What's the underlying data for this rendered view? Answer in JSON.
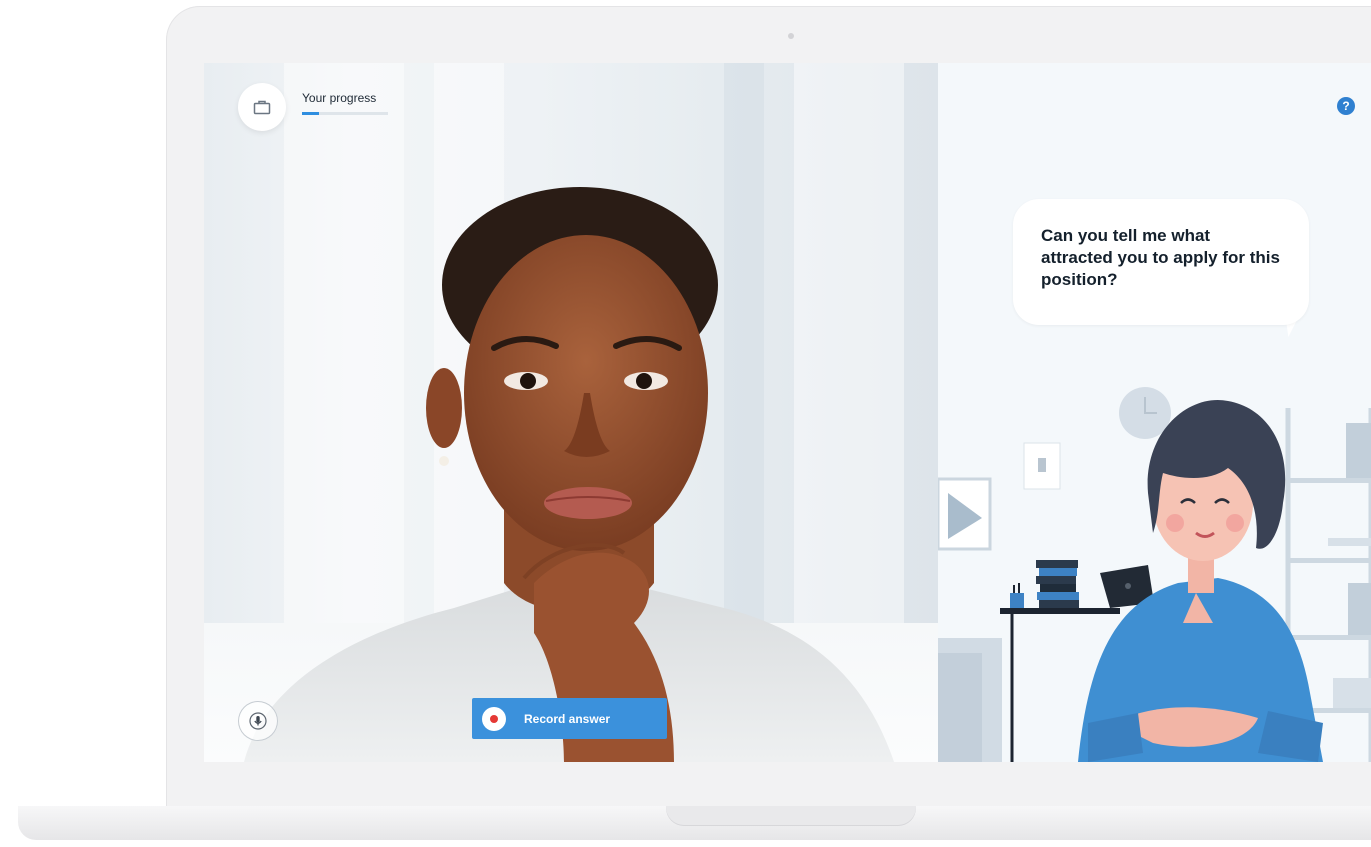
{
  "progress": {
    "label": "Your progress",
    "fraction": 0.2,
    "icon": "briefcase-icon"
  },
  "controls": {
    "mic_icon": "microphone-icon",
    "record_label": "Record answer",
    "record_icon": "record-icon"
  },
  "assistant": {
    "help_glyph": "?",
    "question": "Can you tell me what attracted you to apply for this position?"
  },
  "colors": {
    "accent": "#3b91dc",
    "record_dot": "#e53935",
    "assistant_shirt": "#3f8fd2",
    "assistant_hair": "#3a4255"
  }
}
